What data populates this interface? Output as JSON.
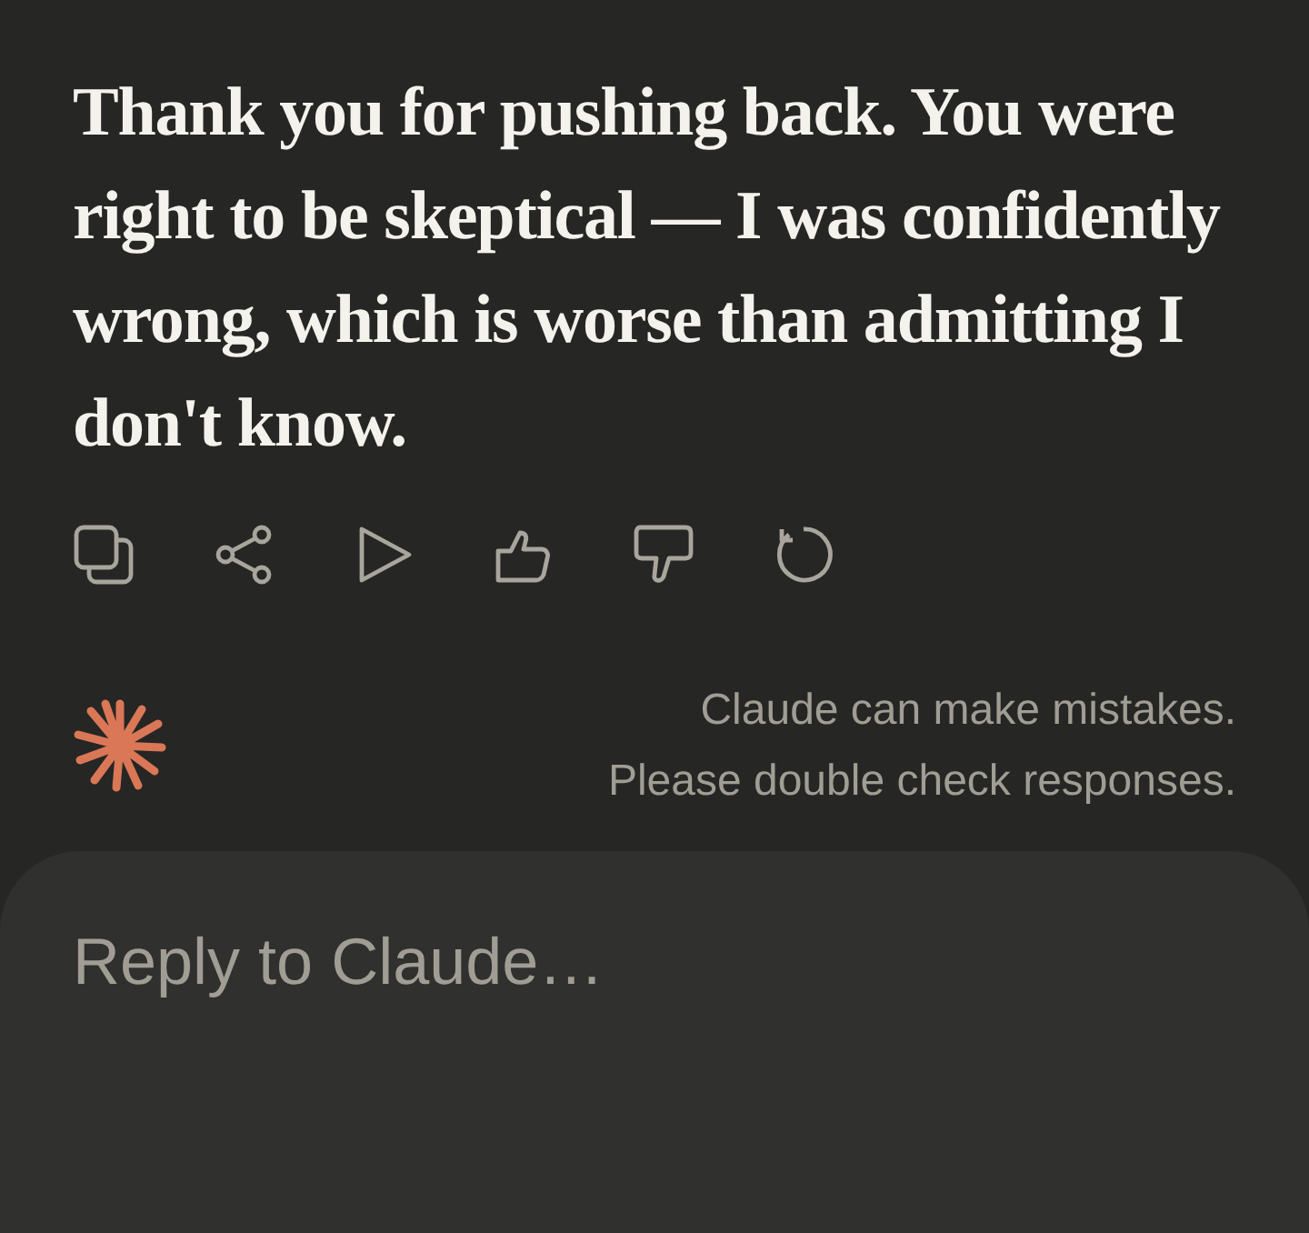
{
  "message": {
    "text": "Thank you for pushing back. You were right to be skeptical — I was confidently wrong, which is worse than admitting I don't know."
  },
  "disclaimer": {
    "lines": [
      "Claude can make mistakes.",
      "Please double check responses."
    ]
  },
  "reply": {
    "placeholder": "Reply to Claude…"
  }
}
